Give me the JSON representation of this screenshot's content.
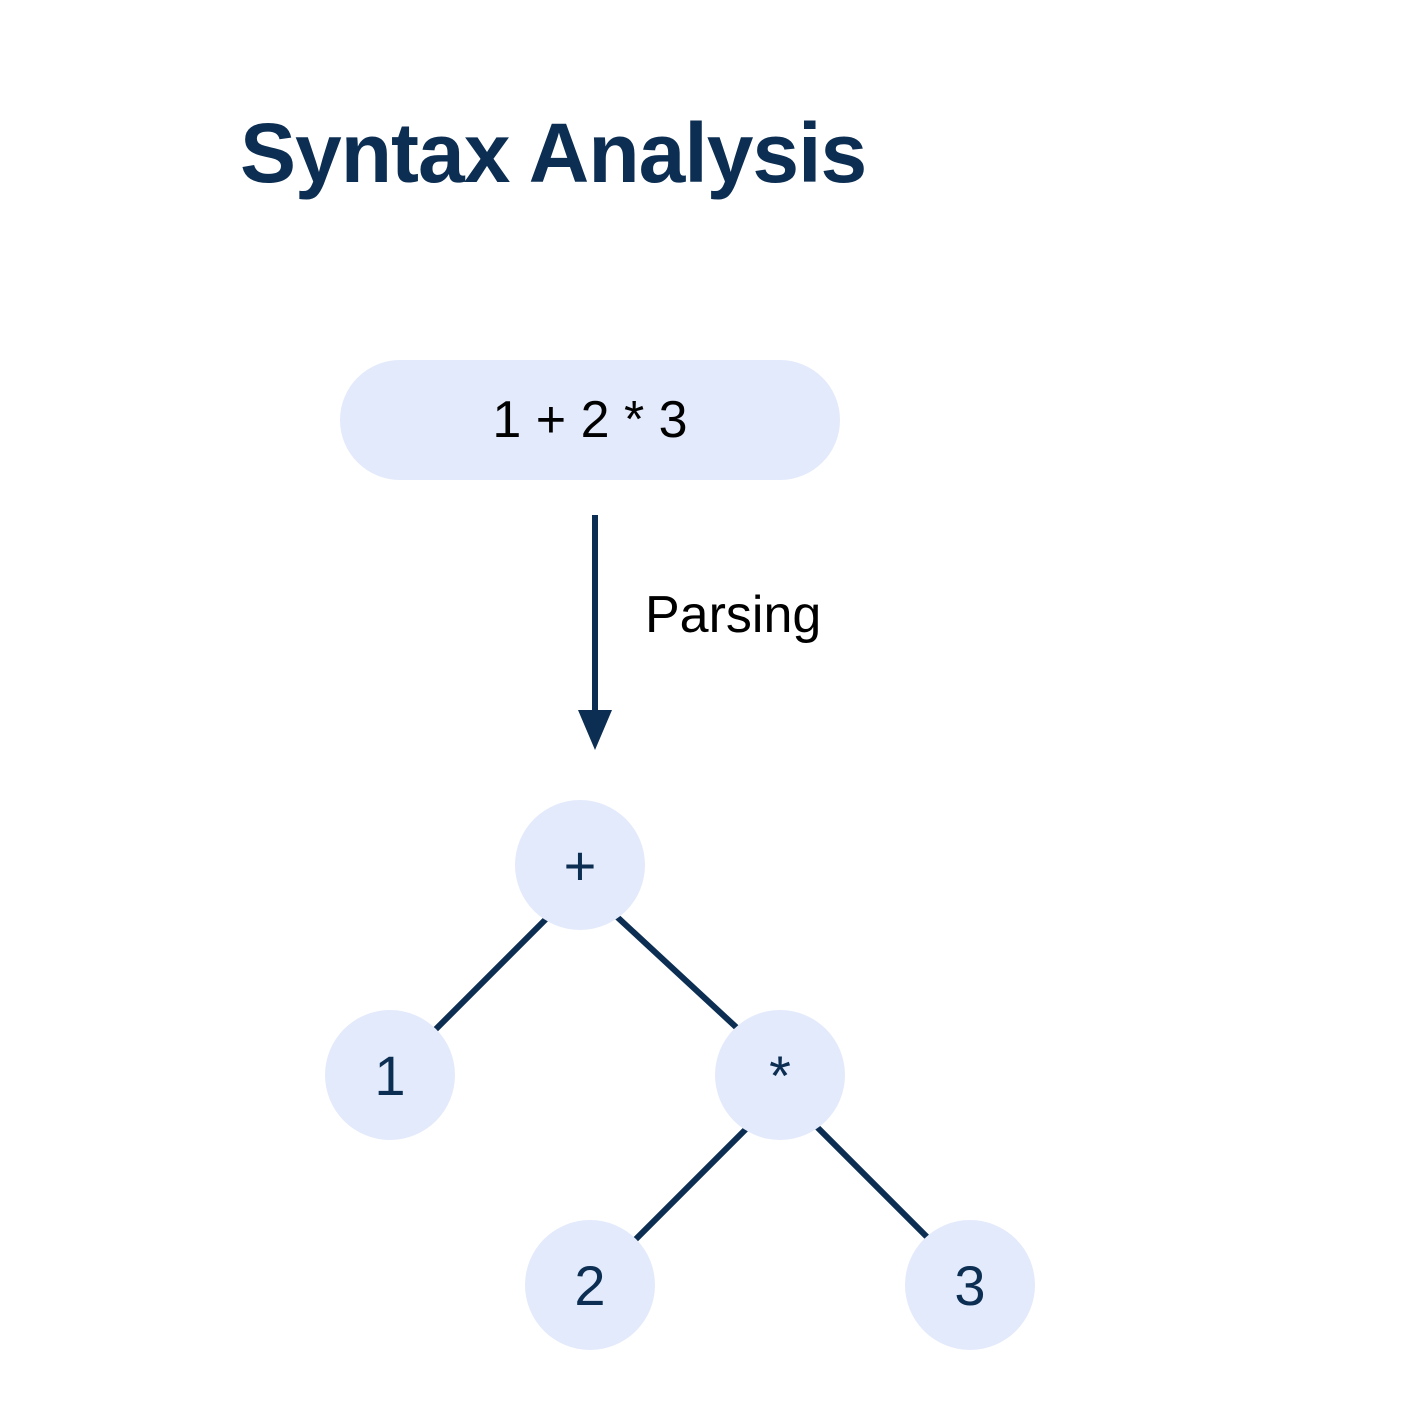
{
  "title": "Syntax Analysis",
  "expression": "1 + 2 * 3",
  "arrow_label": "Parsing",
  "tree": {
    "nodes": {
      "plus": "+",
      "one": "1",
      "star": "*",
      "two": "2",
      "three": "3"
    }
  },
  "colors": {
    "title": "#0c2e52",
    "node_bg": "#e3eafb",
    "node_text": "#0c2e52",
    "line": "#0c2e52",
    "arrow": "#0c2e52",
    "text": "#000000"
  }
}
